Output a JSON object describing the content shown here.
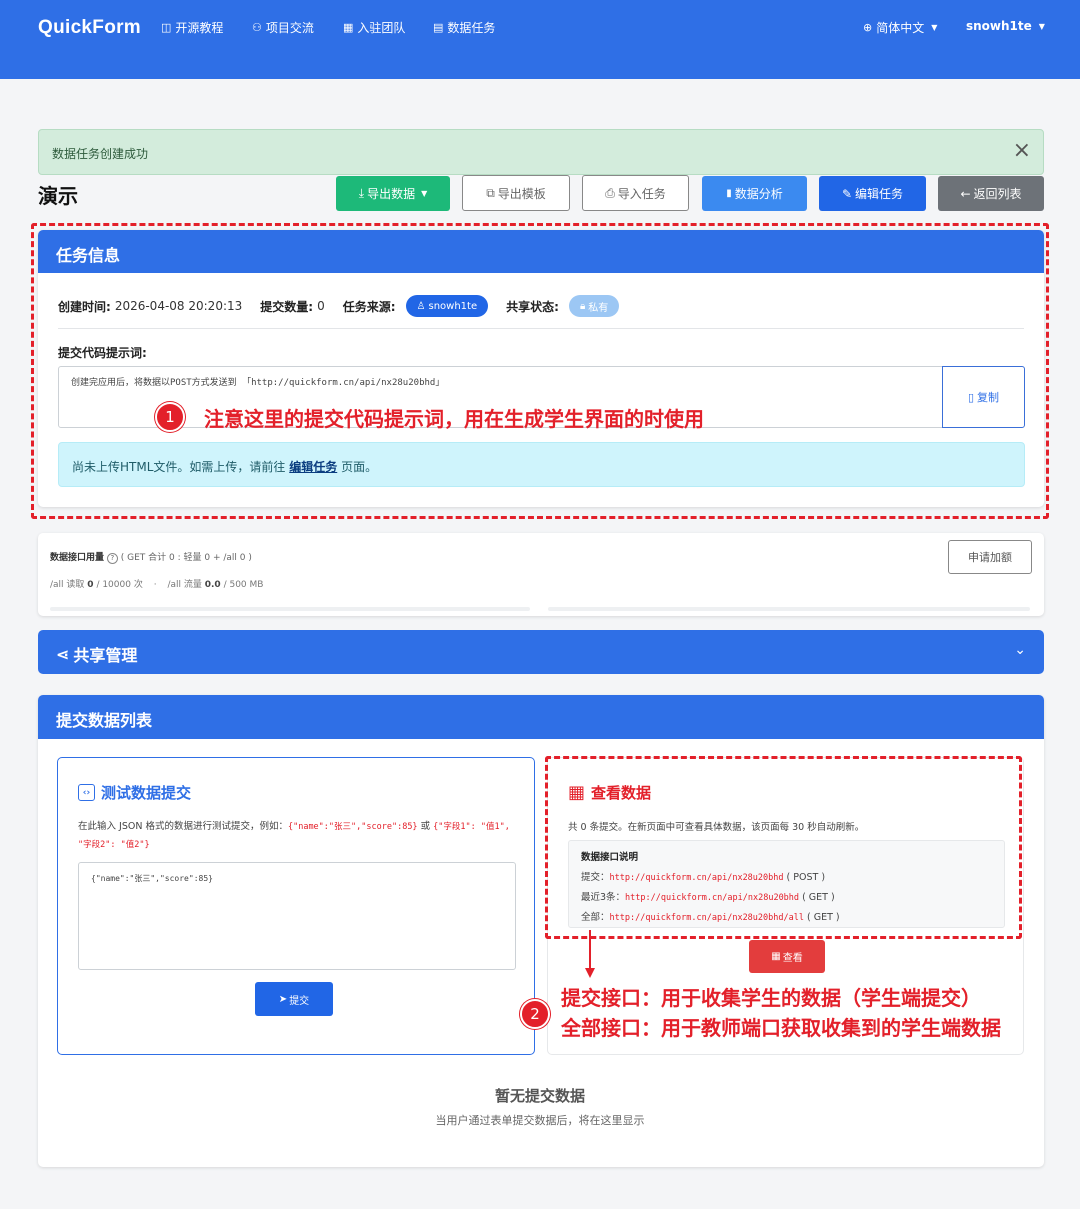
{
  "navbar": {
    "brand": "QuickForm",
    "items": [
      {
        "icon": "book-icon",
        "glyph": "◫",
        "label": "开源教程"
      },
      {
        "icon": "users-icon",
        "glyph": "⚇",
        "label": "项目交流"
      },
      {
        "icon": "building-icon",
        "glyph": "▦",
        "label": "入驻团队"
      },
      {
        "icon": "database-icon",
        "glyph": "▤",
        "label": "数据任务"
      }
    ],
    "language": "简体中文",
    "user": "snowh1te"
  },
  "alert": {
    "message": "数据任务创建成功",
    "close": "×"
  },
  "page": {
    "title": "演示"
  },
  "toolbar": {
    "export_data": "导出数据",
    "export_template": "导出模板",
    "import_task": "导入任务",
    "analysis": "数据分析",
    "edit_task": "编辑任务",
    "back": "返回列表"
  },
  "task_info": {
    "header": "任务信息",
    "created_label": "创建时间:",
    "created_value": "2026-04-08 20:20:13",
    "count_label": "提交数量:",
    "count_value": "0",
    "source_label": "任务来源:",
    "source_value": "snowh1te",
    "share_label": "共享状态:",
    "share_value": "私有",
    "prompt_label": "提交代码提示词:",
    "prompt_text": "创建完应用后，将数据以POST方式发送到 「http://quickform.cn/api/nx28u20bhd」",
    "copy": "复制",
    "info_prefix": "尚未上传HTML文件。如需上传，请前往",
    "info_link": "编辑任务",
    "info_suffix": "页面。"
  },
  "annotations": {
    "one_num": "1",
    "one_text": "注意这里的提交代码提示词，用在生成学生界面的时使用",
    "two_num": "2",
    "two_line1": "提交接口：用于收集学生的数据（学生端提交）",
    "two_line2": "全部接口：用于教师端口获取收集到的学生端数据"
  },
  "usage": {
    "title_prefix": "数据接口用量",
    "title_rest": "( GET 合计 0 : 轻量 0 + /all 0 )",
    "reads_label": "/all 读取",
    "reads_value": "0",
    "reads_limit": "/ 10000 次",
    "sep": "·",
    "traffic_label": "/all 流量",
    "traffic_value": "0.0",
    "traffic_limit": "/ 500 MB",
    "request_quota": "申请加额"
  },
  "share": {
    "title": "共享管理"
  },
  "submissions": {
    "header": "提交数据列表",
    "test": {
      "title": "测试数据提交",
      "desc_prefix": "在此输入 JSON 格式的数据进行测试提交，例如：",
      "example1": "{\"name\":\"张三\",\"score\":85}",
      "or": "或",
      "example2": "{\"字段1\": \"值1\", \"字段2\": \"值2\"}",
      "input_value": "{\"name\":\"张三\",\"score\":85}",
      "submit": "提交"
    },
    "view": {
      "title": "查看数据",
      "desc": "共 0 条提交。在新页面中可查看具体数据，该页面每 30 秒自动刷新。",
      "api_title": "数据接口说明",
      "api_rows": [
        {
          "label": "提交：",
          "url": "http://quickform.cn/api/nx28u20bhd",
          "method": "( POST )"
        },
        {
          "label": "最近3条：",
          "url": "http://quickform.cn/api/nx28u20bhd",
          "method": "( GET )"
        },
        {
          "label": "全部：",
          "url": "http://quickform.cn/api/nx28u20bhd/all",
          "method": "( GET )"
        }
      ],
      "view_btn": "查看"
    },
    "empty_title": "暂无提交数据",
    "empty_sub": "当用户通过表单提交数据后，将在这里显示"
  },
  "colors": {
    "primary": "#2f6fe6",
    "annotation_red": "#e3202a",
    "success": "#1db979"
  }
}
